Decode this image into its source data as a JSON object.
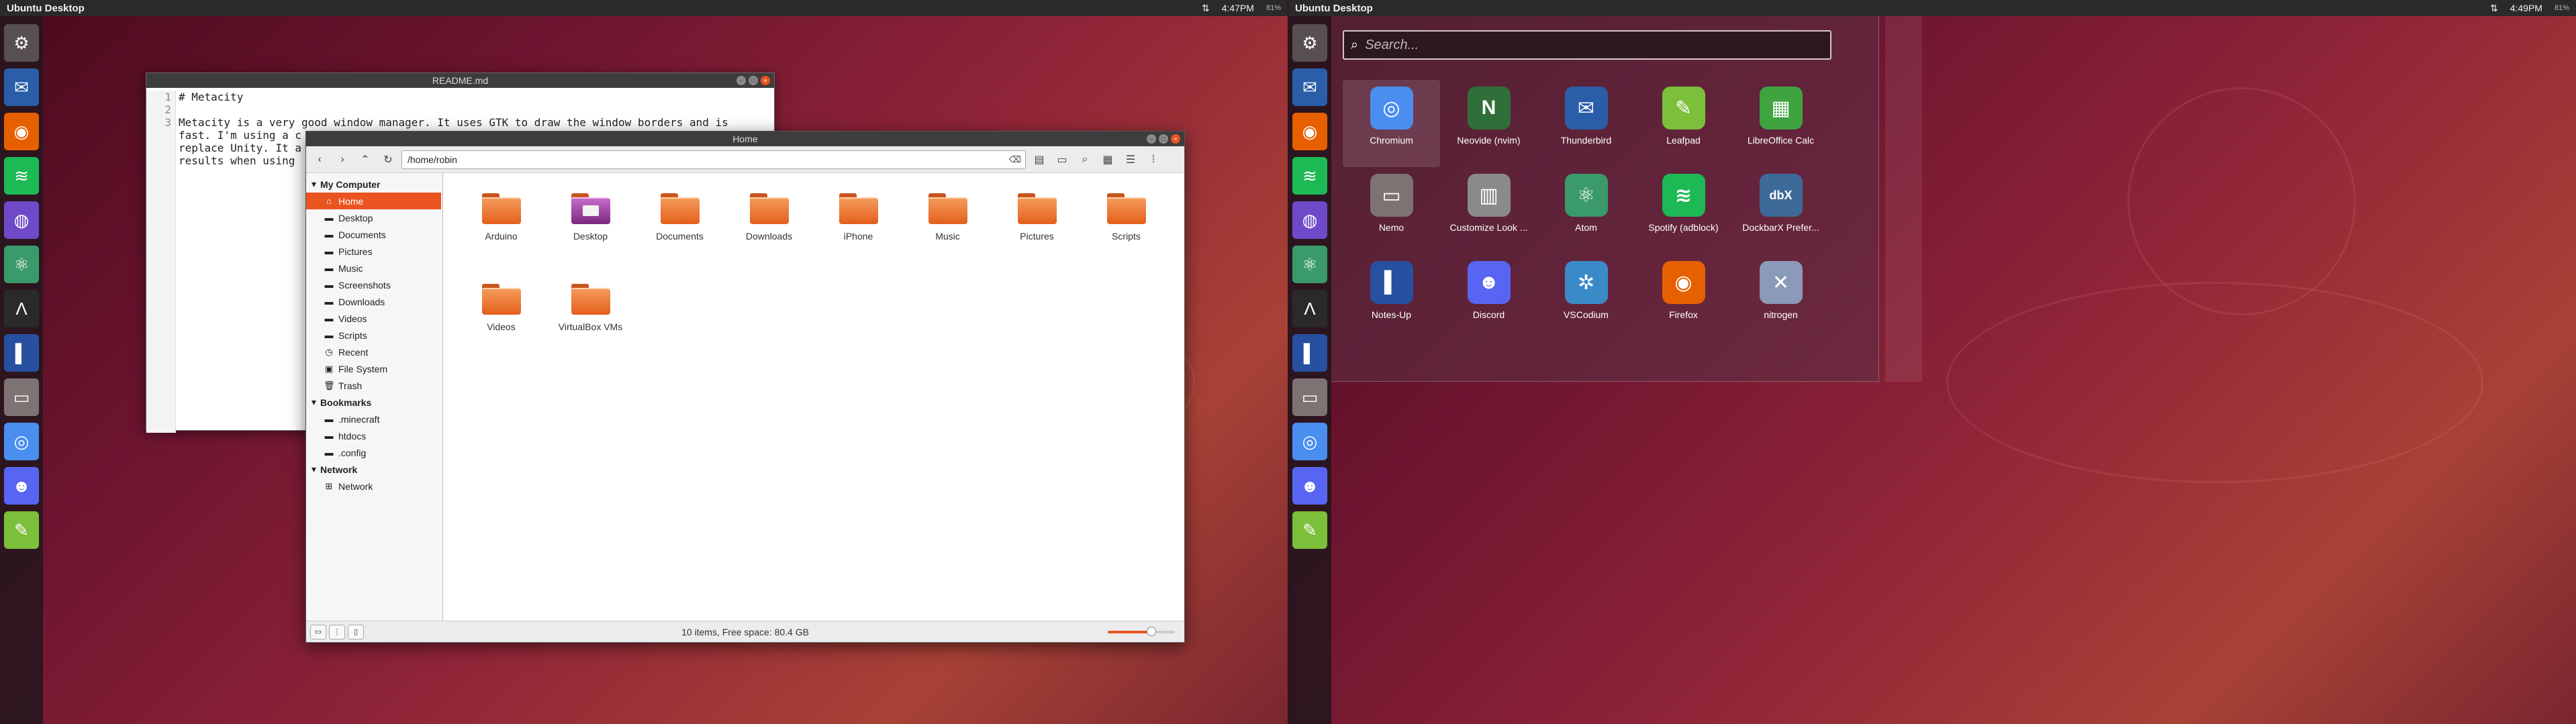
{
  "left_screen": {
    "topbar": {
      "title": "Ubuntu Desktop",
      "time": "4:47PM",
      "battery": "81%"
    },
    "editor": {
      "title": "README.md",
      "line_numbers": [
        "1",
        "2",
        "3"
      ],
      "lines": [
        "# Metacity",
        "",
        "Metacity is a very good window manager. It uses GTK to draw the window borders and is",
        "fast. I'm using a c",
        "replace Unity. It a",
        "results when using"
      ]
    },
    "file_manager": {
      "title": "Home",
      "path": "/home/robin",
      "sidebar": [
        {
          "type": "section",
          "label": "My Computer"
        },
        {
          "type": "item",
          "label": "Home",
          "icon": "home-icon",
          "selected": true
        },
        {
          "type": "item",
          "label": "Desktop",
          "icon": "folder-icon"
        },
        {
          "type": "item",
          "label": "Documents",
          "icon": "folder-icon"
        },
        {
          "type": "item",
          "label": "Pictures",
          "icon": "folder-icon"
        },
        {
          "type": "item",
          "label": "Music",
          "icon": "folder-icon"
        },
        {
          "type": "item",
          "label": "Screenshots",
          "icon": "folder-icon"
        },
        {
          "type": "item",
          "label": "Downloads",
          "icon": "folder-icon"
        },
        {
          "type": "item",
          "label": "Videos",
          "icon": "folder-icon"
        },
        {
          "type": "item",
          "label": "Scripts",
          "icon": "folder-icon"
        },
        {
          "type": "item",
          "label": "Recent",
          "icon": "clock-icon"
        },
        {
          "type": "item",
          "label": "File System",
          "icon": "drive-icon"
        },
        {
          "type": "item",
          "label": "Trash",
          "icon": "trash-icon"
        },
        {
          "type": "section",
          "label": "Bookmarks"
        },
        {
          "type": "item",
          "label": ".minecraft",
          "icon": "folder-icon"
        },
        {
          "type": "item",
          "label": "htdocs",
          "icon": "folder-icon"
        },
        {
          "type": "item",
          "label": ".config",
          "icon": "folder-icon"
        },
        {
          "type": "section",
          "label": "Network"
        },
        {
          "type": "item",
          "label": "Network",
          "icon": "network-icon"
        }
      ],
      "files": [
        {
          "name": "Arduino",
          "kind": "folder"
        },
        {
          "name": "Desktop",
          "kind": "desktop"
        },
        {
          "name": "Documents",
          "kind": "folder"
        },
        {
          "name": "Downloads",
          "kind": "folder"
        },
        {
          "name": "iPhone",
          "kind": "folder"
        },
        {
          "name": "Music",
          "kind": "folder"
        },
        {
          "name": "Pictures",
          "kind": "folder"
        },
        {
          "name": "Scripts",
          "kind": "folder"
        },
        {
          "name": "Videos",
          "kind": "folder"
        },
        {
          "name": "VirtualBox VMs",
          "kind": "folder"
        }
      ],
      "status": "10 items, Free space: 80.4 GB",
      "zoom_level": 0.65
    }
  },
  "right_screen": {
    "topbar": {
      "title": "Ubuntu Desktop",
      "time": "4:49PM",
      "battery": "81%"
    },
    "dash": {
      "search_placeholder": "Search...",
      "apps": [
        {
          "name": "Chromium",
          "icon": "chromium-icon",
          "color": "#4a8ef0",
          "glyph": "◎",
          "selected": true
        },
        {
          "name": "Neovide (nvim)",
          "icon": "neovim-icon",
          "color": "#2f6f3a",
          "glyph": "N"
        },
        {
          "name": "Thunderbird",
          "icon": "thunderbird-icon",
          "color": "#2a5ea8",
          "glyph": "✉"
        },
        {
          "name": "Leafpad",
          "icon": "leafpad-icon",
          "color": "#7cbf3a",
          "glyph": "✎"
        },
        {
          "name": "LibreOffice Calc",
          "icon": "libreoffice-calc-icon",
          "color": "#3fa33f",
          "glyph": "▦"
        },
        {
          "name": "Nemo",
          "icon": "nemo-icon",
          "color": "#7d7373",
          "glyph": "▭"
        },
        {
          "name": "Customize Look ...",
          "icon": "customize-look-icon",
          "color": "#8a8a8a",
          "glyph": "▥"
        },
        {
          "name": "Atom",
          "icon": "atom-icon",
          "color": "#3a9a6a",
          "glyph": "⚛"
        },
        {
          "name": "Spotify (adblock)",
          "icon": "spotify-icon",
          "color": "#1db954",
          "glyph": "≋"
        },
        {
          "name": "DockbarX Prefer...",
          "icon": "dockbarx-icon",
          "color": "#3e6a9a",
          "glyph": "dbX"
        },
        {
          "name": "Notes-Up",
          "icon": "notes-up-icon",
          "color": "#2850a0",
          "glyph": "▌"
        },
        {
          "name": "Discord",
          "icon": "discord-icon",
          "color": "#5865f2",
          "glyph": "☻"
        },
        {
          "name": "VSCodium",
          "icon": "vscodium-icon",
          "color": "#3a8ac8",
          "glyph": "✲"
        },
        {
          "name": "Firefox",
          "icon": "firefox-icon",
          "color": "#e66000",
          "glyph": "◉"
        },
        {
          "name": "nitrogen",
          "icon": "nitrogen-icon",
          "color": "#8a9ab8",
          "glyph": "✕"
        }
      ]
    }
  },
  "launcher": [
    {
      "name": "settings-icon",
      "glyph": "⚙",
      "color": "#585050"
    },
    {
      "name": "thunderbird-icon",
      "glyph": "✉",
      "color": "#2a5ea8"
    },
    {
      "name": "firefox-icon",
      "glyph": "◉",
      "color": "#e66000"
    },
    {
      "name": "spotify-icon",
      "glyph": "≋",
      "color": "#1db954"
    },
    {
      "name": "github-icon",
      "glyph": "◍",
      "color": "#6e4ac8"
    },
    {
      "name": "atom-icon",
      "glyph": "⚛",
      "color": "#3a9a6a"
    },
    {
      "name": "arduino-icon",
      "glyph": "Λ",
      "color": "#2a2a2a"
    },
    {
      "name": "notes-icon",
      "glyph": "▌",
      "color": "#2850a0"
    },
    {
      "name": "nemo-icon",
      "glyph": "▭",
      "color": "#7d7373"
    },
    {
      "name": "chromium-icon",
      "glyph": "◎",
      "color": "#4a8ef0"
    },
    {
      "name": "discord-icon",
      "glyph": "☻",
      "color": "#5865f2"
    },
    {
      "name": "leafpad-icon",
      "glyph": "✎",
      "color": "#7cbf3a"
    }
  ]
}
